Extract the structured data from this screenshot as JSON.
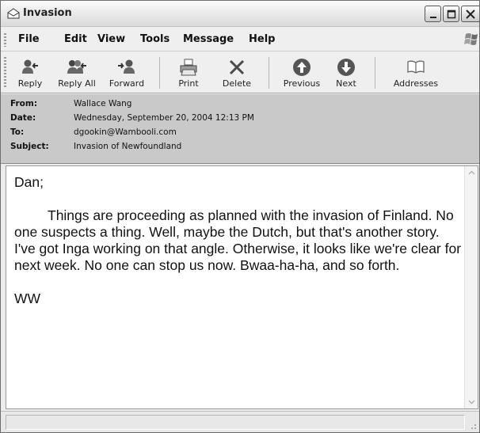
{
  "window": {
    "title": "Invasion"
  },
  "menu": {
    "items": [
      "File",
      "Edit",
      "View",
      "Tools",
      "Message",
      "Help"
    ]
  },
  "toolbar": {
    "reply": "Reply",
    "reply_all": "Reply All",
    "forward": "Forward",
    "print": "Print",
    "delete": "Delete",
    "previous": "Previous",
    "next": "Next",
    "addresses": "Addresses"
  },
  "headers": {
    "from_label": "From:",
    "from_value": "Wallace Wang",
    "date_label": "Date:",
    "date_value": "Wednesday, September 20, 2004 12:13 PM",
    "to_label": "To:",
    "to_value": "dgookin@Wambooli.com",
    "subject_label": "Subject:",
    "subject_value": "Invasion of Newfoundland"
  },
  "message": {
    "greeting": "Dan;",
    "paragraph": "Things are proceeding as planned with the invasion of Finland. No one suspects a thing. Well, maybe the Dutch, but that's another story. I've got Inga working on that angle. Otherwise, it looks like we're clear for next week. No one can stop us now. Bwaa-ha-ha, and so forth.",
    "signature": "WW"
  },
  "icons": {
    "title": "envelope-open-icon",
    "reply": "reply-icon",
    "reply_all": "reply-all-icon",
    "forward": "forward-icon",
    "print": "printer-icon",
    "delete": "delete-x-icon",
    "previous": "up-arrow-icon",
    "next": "down-arrow-icon",
    "addresses": "address-book-icon"
  }
}
